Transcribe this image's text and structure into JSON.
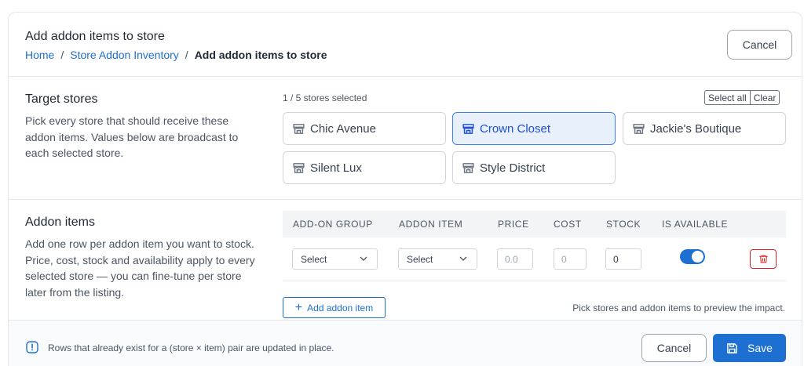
{
  "header": {
    "title": "Add addon items to store",
    "breadcrumb": [
      "Home",
      "Store Addon Inventory",
      "Add addon items to store"
    ],
    "separator": "/",
    "cancel_label": "Cancel"
  },
  "target_stores": {
    "title": "Target stores",
    "description": "Pick every store that should receive these addon items. Values below are broadcast to each selected store.",
    "selected_count_text": "1 / 5 stores selected",
    "select_all_label": "Select all",
    "clear_label": "Clear",
    "stores": [
      {
        "name": "Chic Avenue",
        "selected": false
      },
      {
        "name": "Crown Closet",
        "selected": true
      },
      {
        "name": "Jackie's Boutique",
        "selected": false
      },
      {
        "name": "Silent Lux",
        "selected": false
      },
      {
        "name": "Style District",
        "selected": false
      }
    ]
  },
  "addon_items": {
    "title": "Addon items",
    "description": "Add one row per addon item you want to stock. Price, cost, stock and availability apply to every selected store — you can fine-tune per store later from the listing.",
    "columns": [
      "ADD-ON GROUP",
      "ADDON ITEM",
      "PRICE",
      "COST",
      "STOCK",
      "IS AVAILABLE"
    ],
    "rows": [
      {
        "group": "Select",
        "item": "Select",
        "price_placeholder": "0.0",
        "cost_placeholder": "0",
        "stock": "0",
        "is_available": true
      }
    ],
    "add_item_label": "Add addon item",
    "preview_hint": "Pick stores and addon items to preview the impact."
  },
  "footer": {
    "note": "Rows that already exist for a (store × item) pair are updated in place.",
    "cancel_label": "Cancel",
    "save_label": "Save"
  },
  "colors": {
    "primary": "#1d6fd1",
    "danger": "#dc2626",
    "selected_bg": "#e8f1fb"
  }
}
